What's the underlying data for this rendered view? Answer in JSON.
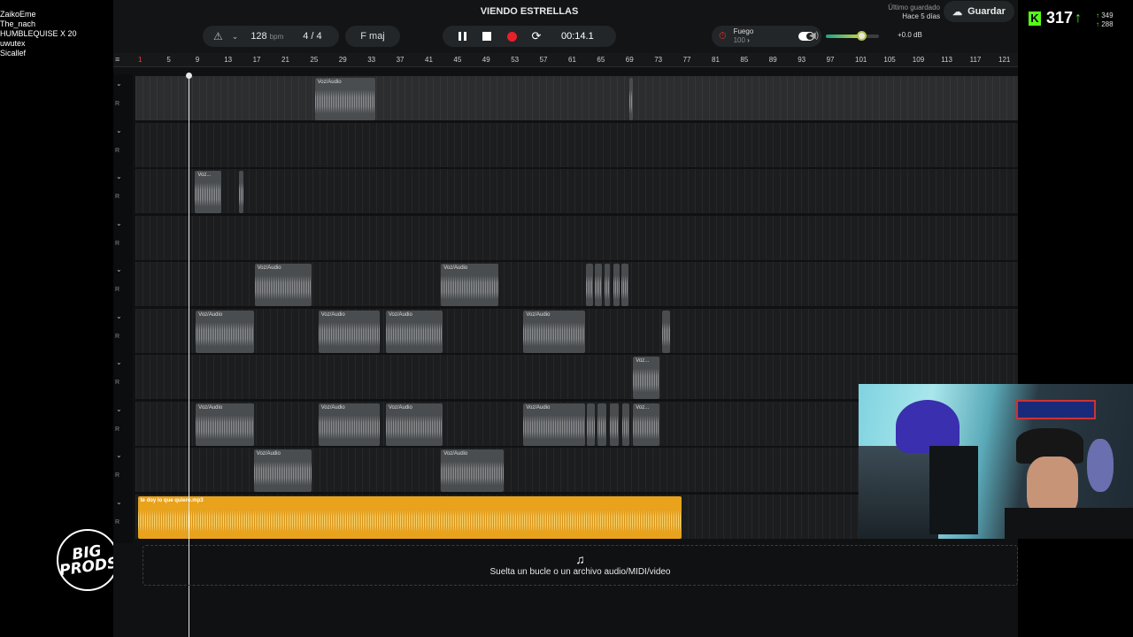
{
  "chat": [
    "ZaikoEme",
    "The_nach",
    "HUMBLEQUISE X 20",
    "uwutex",
    "Sicallef"
  ],
  "logo": {
    "line1": "BIG",
    "line2": "PRODS"
  },
  "project": {
    "title": "VIENDO ESTRELLAS"
  },
  "toolbar": {
    "bpm": "128",
    "bpm_unit": "bpm",
    "time_signature": "4 / 4",
    "key": "F maj",
    "time": "00:14.1",
    "master_name": "Fuego",
    "master_value": "100",
    "volume_db": "+0.0 dB",
    "volume_level": 0.68,
    "saved_label": "Último guardado",
    "saved_when": "Hace 5 días",
    "save_label": "Guardar"
  },
  "ruler": {
    "ticks": [
      "1",
      "5",
      "9",
      "13",
      "17",
      "21",
      "25",
      "29",
      "33",
      "37",
      "41",
      "45",
      "49",
      "53",
      "57",
      "61",
      "65",
      "69",
      "73",
      "77",
      "81",
      "85",
      "89",
      "93",
      "97",
      "101",
      "105",
      "109",
      "113",
      "117",
      "121"
    ],
    "active_tick": "1"
  },
  "tracks": [
    {
      "clips": [
        {
          "label": "Voz/Audio",
          "start": 25.4,
          "end": 33.9
        },
        {
          "label": "",
          "start": 69.3,
          "end": 69.8
        }
      ],
      "selected": true
    },
    {
      "clips": []
    },
    {
      "clips": [
        {
          "label": "Voz...",
          "start": 8.7,
          "end": 12.4
        },
        {
          "label": "",
          "start": 14.8,
          "end": 15.4
        }
      ]
    },
    {
      "clips": []
    },
    {
      "clips": [
        {
          "label": "Voz/Audio",
          "start": 17.0,
          "end": 24.9
        },
        {
          "label": "Voz/Audio",
          "start": 43.0,
          "end": 51.0
        },
        {
          "label": "",
          "start": 63.2,
          "end": 64.2
        },
        {
          "label": "",
          "start": 64.5,
          "end": 65.4
        },
        {
          "label": "",
          "start": 65.8,
          "end": 66.6
        },
        {
          "label": "",
          "start": 67.0,
          "end": 67.9
        },
        {
          "label": "",
          "start": 68.2,
          "end": 69.2
        }
      ]
    },
    {
      "clips": [
        {
          "label": "Voz/Audio",
          "start": 8.8,
          "end": 16.9
        },
        {
          "label": "Voz/Audio",
          "start": 25.9,
          "end": 34.4
        },
        {
          "label": "Voz/Audio",
          "start": 35.3,
          "end": 43.2
        },
        {
          "label": "Voz/Audio",
          "start": 54.5,
          "end": 63.1
        },
        {
          "label": "",
          "start": 73.8,
          "end": 75.0
        }
      ]
    },
    {
      "clips": [
        {
          "label": "Voz...",
          "start": 69.8,
          "end": 73.5
        }
      ]
    },
    {
      "clips": [
        {
          "label": "Voz/Audio",
          "start": 8.8,
          "end": 16.9
        },
        {
          "label": "Voz/Audio",
          "start": 25.9,
          "end": 34.4
        },
        {
          "label": "Voz/Audio",
          "start": 35.3,
          "end": 43.2
        },
        {
          "label": "Voz/Audio",
          "start": 54.5,
          "end": 63.1
        },
        {
          "label": "",
          "start": 63.3,
          "end": 64.4
        },
        {
          "label": "",
          "start": 64.8,
          "end": 66.1
        },
        {
          "label": "",
          "start": 66.5,
          "end": 67.8
        },
        {
          "label": "",
          "start": 68.3,
          "end": 69.3
        },
        {
          "label": "Voz...",
          "start": 69.8,
          "end": 73.5
        }
      ]
    },
    {
      "clips": [
        {
          "label": "Voz/Audio",
          "start": 16.9,
          "end": 24.9
        },
        {
          "label": "Voz/Audio",
          "start": 43.0,
          "end": 51.8
        }
      ]
    },
    {
      "clips": [
        {
          "label": "te doy lo que quiero.mp3",
          "start": 0.7,
          "end": 76.5,
          "color": "gold"
        }
      ]
    }
  ],
  "track_header_labels": {
    "chevron": "⌄",
    "io": "R"
  },
  "dropzone": {
    "text": "Suelta un bucle o un archivo audio/MIDI/video"
  },
  "overlay": {
    "viewer_count": "317",
    "stat1": "349",
    "stat2": "288"
  },
  "icons": {
    "metronome": "metronome-icon",
    "pause": "pause-icon",
    "stop": "stop-icon",
    "record": "record-icon",
    "loop": "loop-icon",
    "volume": "speaker-icon",
    "cloud": "cloud-upload-icon",
    "music": "music-note-plus-icon"
  },
  "colors": {
    "record": "#e8202a",
    "clip_gold": "#e8a21c",
    "kick_green": "#53fc18"
  }
}
